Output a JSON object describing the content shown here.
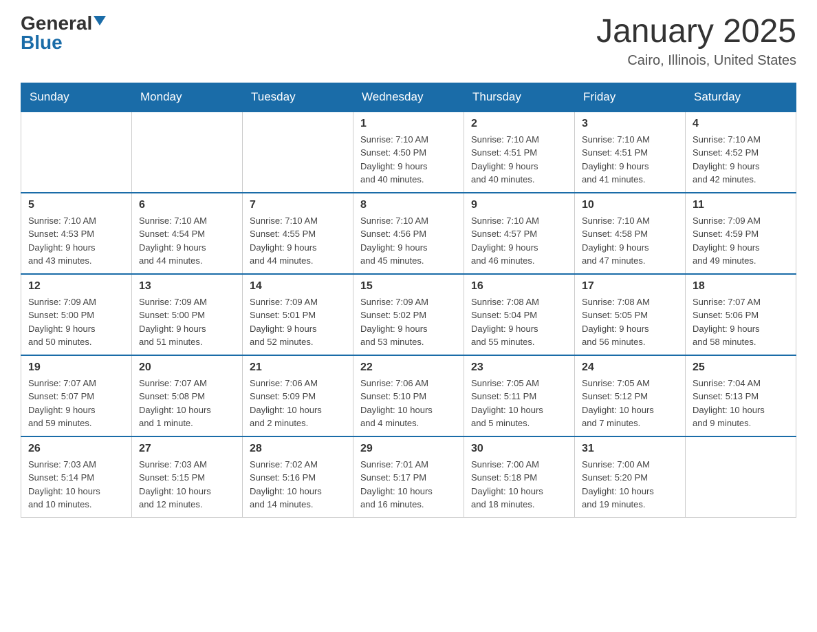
{
  "header": {
    "logo_general": "General",
    "logo_blue": "Blue",
    "title": "January 2025",
    "subtitle": "Cairo, Illinois, United States"
  },
  "days_of_week": [
    "Sunday",
    "Monday",
    "Tuesday",
    "Wednesday",
    "Thursday",
    "Friday",
    "Saturday"
  ],
  "weeks": [
    [
      {
        "num": "",
        "info": ""
      },
      {
        "num": "",
        "info": ""
      },
      {
        "num": "",
        "info": ""
      },
      {
        "num": "1",
        "info": "Sunrise: 7:10 AM\nSunset: 4:50 PM\nDaylight: 9 hours\nand 40 minutes."
      },
      {
        "num": "2",
        "info": "Sunrise: 7:10 AM\nSunset: 4:51 PM\nDaylight: 9 hours\nand 40 minutes."
      },
      {
        "num": "3",
        "info": "Sunrise: 7:10 AM\nSunset: 4:51 PM\nDaylight: 9 hours\nand 41 minutes."
      },
      {
        "num": "4",
        "info": "Sunrise: 7:10 AM\nSunset: 4:52 PM\nDaylight: 9 hours\nand 42 minutes."
      }
    ],
    [
      {
        "num": "5",
        "info": "Sunrise: 7:10 AM\nSunset: 4:53 PM\nDaylight: 9 hours\nand 43 minutes."
      },
      {
        "num": "6",
        "info": "Sunrise: 7:10 AM\nSunset: 4:54 PM\nDaylight: 9 hours\nand 44 minutes."
      },
      {
        "num": "7",
        "info": "Sunrise: 7:10 AM\nSunset: 4:55 PM\nDaylight: 9 hours\nand 44 minutes."
      },
      {
        "num": "8",
        "info": "Sunrise: 7:10 AM\nSunset: 4:56 PM\nDaylight: 9 hours\nand 45 minutes."
      },
      {
        "num": "9",
        "info": "Sunrise: 7:10 AM\nSunset: 4:57 PM\nDaylight: 9 hours\nand 46 minutes."
      },
      {
        "num": "10",
        "info": "Sunrise: 7:10 AM\nSunset: 4:58 PM\nDaylight: 9 hours\nand 47 minutes."
      },
      {
        "num": "11",
        "info": "Sunrise: 7:09 AM\nSunset: 4:59 PM\nDaylight: 9 hours\nand 49 minutes."
      }
    ],
    [
      {
        "num": "12",
        "info": "Sunrise: 7:09 AM\nSunset: 5:00 PM\nDaylight: 9 hours\nand 50 minutes."
      },
      {
        "num": "13",
        "info": "Sunrise: 7:09 AM\nSunset: 5:00 PM\nDaylight: 9 hours\nand 51 minutes."
      },
      {
        "num": "14",
        "info": "Sunrise: 7:09 AM\nSunset: 5:01 PM\nDaylight: 9 hours\nand 52 minutes."
      },
      {
        "num": "15",
        "info": "Sunrise: 7:09 AM\nSunset: 5:02 PM\nDaylight: 9 hours\nand 53 minutes."
      },
      {
        "num": "16",
        "info": "Sunrise: 7:08 AM\nSunset: 5:04 PM\nDaylight: 9 hours\nand 55 minutes."
      },
      {
        "num": "17",
        "info": "Sunrise: 7:08 AM\nSunset: 5:05 PM\nDaylight: 9 hours\nand 56 minutes."
      },
      {
        "num": "18",
        "info": "Sunrise: 7:07 AM\nSunset: 5:06 PM\nDaylight: 9 hours\nand 58 minutes."
      }
    ],
    [
      {
        "num": "19",
        "info": "Sunrise: 7:07 AM\nSunset: 5:07 PM\nDaylight: 9 hours\nand 59 minutes."
      },
      {
        "num": "20",
        "info": "Sunrise: 7:07 AM\nSunset: 5:08 PM\nDaylight: 10 hours\nand 1 minute."
      },
      {
        "num": "21",
        "info": "Sunrise: 7:06 AM\nSunset: 5:09 PM\nDaylight: 10 hours\nand 2 minutes."
      },
      {
        "num": "22",
        "info": "Sunrise: 7:06 AM\nSunset: 5:10 PM\nDaylight: 10 hours\nand 4 minutes."
      },
      {
        "num": "23",
        "info": "Sunrise: 7:05 AM\nSunset: 5:11 PM\nDaylight: 10 hours\nand 5 minutes."
      },
      {
        "num": "24",
        "info": "Sunrise: 7:05 AM\nSunset: 5:12 PM\nDaylight: 10 hours\nand 7 minutes."
      },
      {
        "num": "25",
        "info": "Sunrise: 7:04 AM\nSunset: 5:13 PM\nDaylight: 10 hours\nand 9 minutes."
      }
    ],
    [
      {
        "num": "26",
        "info": "Sunrise: 7:03 AM\nSunset: 5:14 PM\nDaylight: 10 hours\nand 10 minutes."
      },
      {
        "num": "27",
        "info": "Sunrise: 7:03 AM\nSunset: 5:15 PM\nDaylight: 10 hours\nand 12 minutes."
      },
      {
        "num": "28",
        "info": "Sunrise: 7:02 AM\nSunset: 5:16 PM\nDaylight: 10 hours\nand 14 minutes."
      },
      {
        "num": "29",
        "info": "Sunrise: 7:01 AM\nSunset: 5:17 PM\nDaylight: 10 hours\nand 16 minutes."
      },
      {
        "num": "30",
        "info": "Sunrise: 7:00 AM\nSunset: 5:18 PM\nDaylight: 10 hours\nand 18 minutes."
      },
      {
        "num": "31",
        "info": "Sunrise: 7:00 AM\nSunset: 5:20 PM\nDaylight: 10 hours\nand 19 minutes."
      },
      {
        "num": "",
        "info": ""
      }
    ]
  ]
}
